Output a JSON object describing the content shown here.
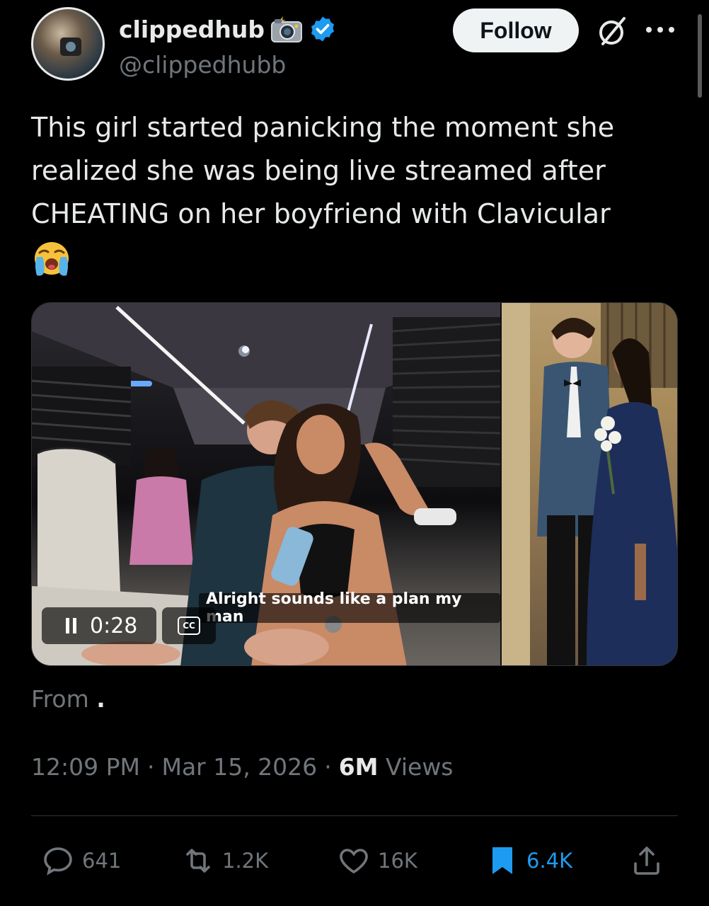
{
  "author": {
    "display_name": "clippedhub",
    "handle": "@clippedhubb",
    "verified_color": "#1d9bf0"
  },
  "header": {
    "follow_label": "Follow"
  },
  "tweet": {
    "text": "This girl started panicking the moment she realized she was being live streamed after CHEATING on her boyfriend with Clavicular",
    "emoji": "loudly-crying-face"
  },
  "media": {
    "video": {
      "caption": "Alright sounds like a plan my man",
      "time": "0:28",
      "cc_label": "CC"
    }
  },
  "source": {
    "label": "From",
    "dot": "."
  },
  "meta": {
    "time": "12:09 PM",
    "sep1": "·",
    "date": "Mar 15, 2026",
    "sep2": "·",
    "views_count": "6M",
    "views_label": "Views"
  },
  "actions": {
    "replies": "641",
    "reposts": "1.2K",
    "likes": "16K",
    "bookmarks": "6.4K"
  },
  "colors": {
    "background": "#000000",
    "text": "#e7e9ea",
    "muted": "#71767b",
    "accent": "#1d9bf0"
  }
}
